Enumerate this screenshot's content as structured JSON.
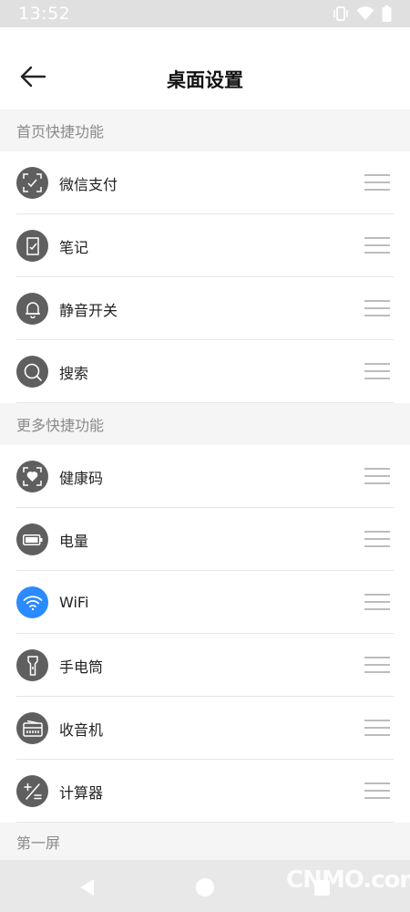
{
  "status_bar": {
    "time": "13:52",
    "icons": [
      "vibrate-icon",
      "wifi-icon",
      "battery-icon"
    ]
  },
  "header": {
    "back_icon": "arrow-left-icon",
    "title": "桌面设置"
  },
  "sections": {
    "home_shortcuts": {
      "title": "首页快捷功能",
      "items": [
        {
          "label": "微信支付",
          "icon": "wechat-pay-scan-icon"
        },
        {
          "label": "笔记",
          "icon": "note-icon"
        },
        {
          "label": "静音开关",
          "icon": "bell-icon"
        },
        {
          "label": "搜索",
          "icon": "search-icon"
        }
      ]
    },
    "more_shortcuts": {
      "title": "更多快捷功能",
      "items": [
        {
          "label": "健康码",
          "icon": "health-code-icon"
        },
        {
          "label": "电量",
          "icon": "battery-icon"
        },
        {
          "label": "WiFi",
          "icon": "wifi-icon",
          "accent": "#2b8aff"
        },
        {
          "label": "手电筒",
          "icon": "flashlight-icon"
        },
        {
          "label": "收音机",
          "icon": "radio-icon"
        },
        {
          "label": "计算器",
          "icon": "calculator-icon"
        }
      ]
    },
    "first_screen": {
      "title": "第一屏"
    }
  },
  "nav_bar": {
    "buttons": [
      "nav-back-icon",
      "nav-home-icon",
      "nav-recents-icon"
    ]
  },
  "watermark": "CNMO.com",
  "colors": {
    "icon_bg": "#5f5f5f",
    "accent": "#2b8aff",
    "section_bg": "#f5f5f5",
    "section_text": "#8a8a8a"
  }
}
